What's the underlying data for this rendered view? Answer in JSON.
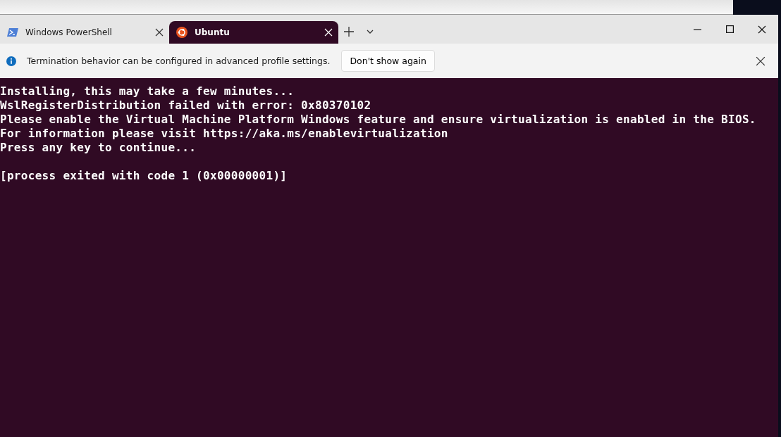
{
  "tabs": [
    {
      "label": "Windows PowerShell",
      "kind": "powershell",
      "selected": false
    },
    {
      "label": "Ubuntu",
      "kind": "ubuntu",
      "selected": true
    }
  ],
  "info_bar": {
    "message": "Termination behavior can be configured in advanced profile settings.",
    "button": "Don't show again"
  },
  "terminal": {
    "output": [
      "Installing, this may take a few minutes...",
      "WslRegisterDistribution failed with error: 0x80370102",
      "Please enable the Virtual Machine Platform Windows feature and ensure virtualization is enabled in the BIOS.",
      "For information please visit https://aka.ms/enablevirtualization",
      "Press any key to continue..."
    ],
    "exit_message": "[process exited with code 1 (0x00000001)]"
  }
}
